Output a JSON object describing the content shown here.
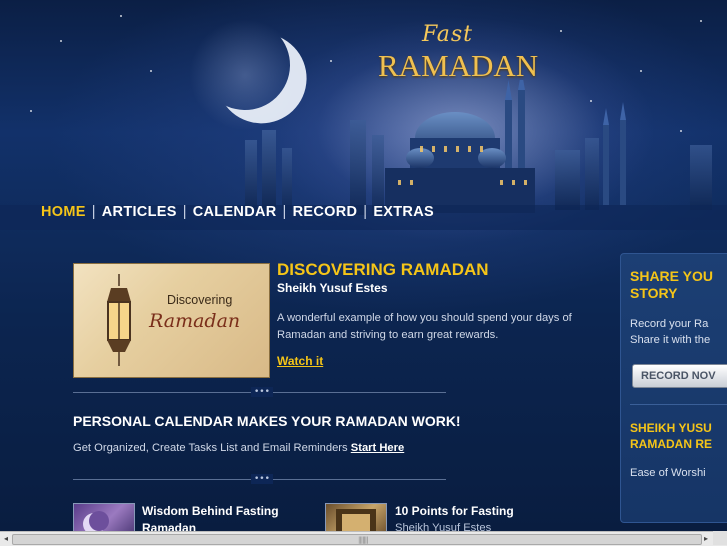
{
  "logo": {
    "top": "Fast",
    "main": "RAMADAN"
  },
  "nav": {
    "items": [
      {
        "label": "HOME",
        "active": true
      },
      {
        "label": "ARTICLES",
        "active": false
      },
      {
        "label": "CALENDAR",
        "active": false
      },
      {
        "label": "RECORD",
        "active": false
      },
      {
        "label": "EXTRAS",
        "active": false
      }
    ],
    "separator": "|"
  },
  "feature": {
    "image_text_1": "Discovering",
    "image_text_2": "Ramadan",
    "title": "DISCOVERING RAMADAN",
    "author": "Sheikh Yusuf Estes",
    "description": "A wonderful example of how you should spend your days of Ramadan and striving to earn great rewards.",
    "link": "Watch it"
  },
  "calendar": {
    "title": "PERSONAL CALENDAR MAKES YOUR RAMADAN WORK!",
    "description": "Get Organized, Create Tasks List and Email Reminders",
    "link": "Start Here"
  },
  "divider_ornament": "•••",
  "articles": [
    {
      "title_line1": "Wisdom Behind Fasting",
      "title_line2": "Ramadan"
    },
    {
      "title_line1": "10 Points for Fasting",
      "subtitle": "Sheikh Yusuf Estes"
    }
  ],
  "sidebar": {
    "share_heading_1": "SHARE YOU",
    "share_heading_2": "STORY",
    "share_text_1": "Record your Ra",
    "share_text_2": "Share it with the",
    "record_button": "RECORD NOV",
    "sheikh_heading_1": "SHEIKH YUSU",
    "sheikh_heading_2": "RAMADAN RE",
    "sheikh_text": "Ease of Worshi"
  },
  "colors": {
    "accent": "#f5c518",
    "background": "#0d2347",
    "text": "#d0d8e8"
  },
  "scrollbar": {
    "left_arrow": "◂",
    "right_arrow": "▸",
    "grip": "|||||||"
  }
}
